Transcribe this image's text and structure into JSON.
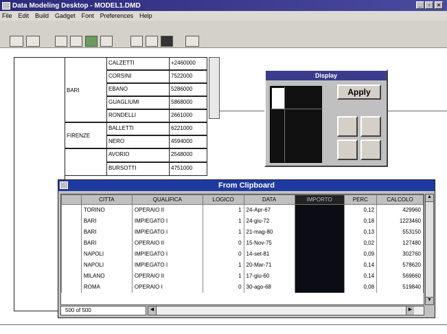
{
  "window": {
    "title": "Data Modeling Desktop - MODEL1.DMD"
  },
  "menu": [
    "File",
    "Edit",
    "Build",
    "Gadget",
    "Font",
    "Preferences",
    "Help"
  ],
  "background_table": {
    "groups": [
      {
        "city": "BARI",
        "rows": [
          [
            "CALZETTI",
            "+2460000"
          ],
          [
            "CORSINI",
            "7522000"
          ],
          [
            "EBANO",
            "5286000"
          ],
          [
            "GUAGLIUMI",
            "5868000"
          ],
          [
            "RONDELLI",
            "2661000"
          ]
        ]
      },
      {
        "city": "FIRENZE",
        "rows": [
          [
            "BALLETTI",
            "6221000"
          ],
          [
            "NERO",
            "4594000"
          ]
        ]
      },
      {
        "city": "",
        "rows": [
          [
            "AVORIO",
            "2548000"
          ],
          [
            "BURSOTTI",
            "4751000"
          ]
        ]
      }
    ]
  },
  "display_panel": {
    "title": "Display",
    "apply_label": "Apply"
  },
  "clipboard": {
    "title": "From Clipboard",
    "columns": [
      "CITTA",
      "QUALIFICA",
      "LOGICO",
      "DATA",
      "IMPORTO",
      "PERC",
      "CALCOLO"
    ],
    "rows": [
      [
        "TORINO",
        "OPERAIO II",
        "1",
        "24-Apr-67",
        "",
        "0,12",
        "429960"
      ],
      [
        "BARI",
        "IMPIEGATO I",
        "1",
        "24-giu-72",
        "",
        "0,18",
        "1223460"
      ],
      [
        "BARI",
        "IMPIEGATO I",
        "1",
        "21-mag-80",
        "",
        "0,13",
        "553150"
      ],
      [
        "BARI",
        "OPERAIO II",
        "0",
        "15-Nov-75",
        "",
        "0,02",
        "127480"
      ],
      [
        "NAPOLI",
        "IMPIEGATO I",
        "0",
        "14-set-81",
        "",
        "0,09",
        "302760"
      ],
      [
        "NAPOLI",
        "IMPIEGATO I",
        "1",
        "20-Mar-71",
        "",
        "0,14",
        "578620"
      ],
      [
        "MILANO",
        "OPERAIO II",
        "1",
        "17-giu-60",
        "",
        "0,14",
        "569660"
      ],
      [
        "ROMA",
        "OPERAIO I",
        "0",
        "30-ago-68",
        "",
        "0,08",
        "519840"
      ]
    ],
    "record_status": "500 of 500"
  }
}
